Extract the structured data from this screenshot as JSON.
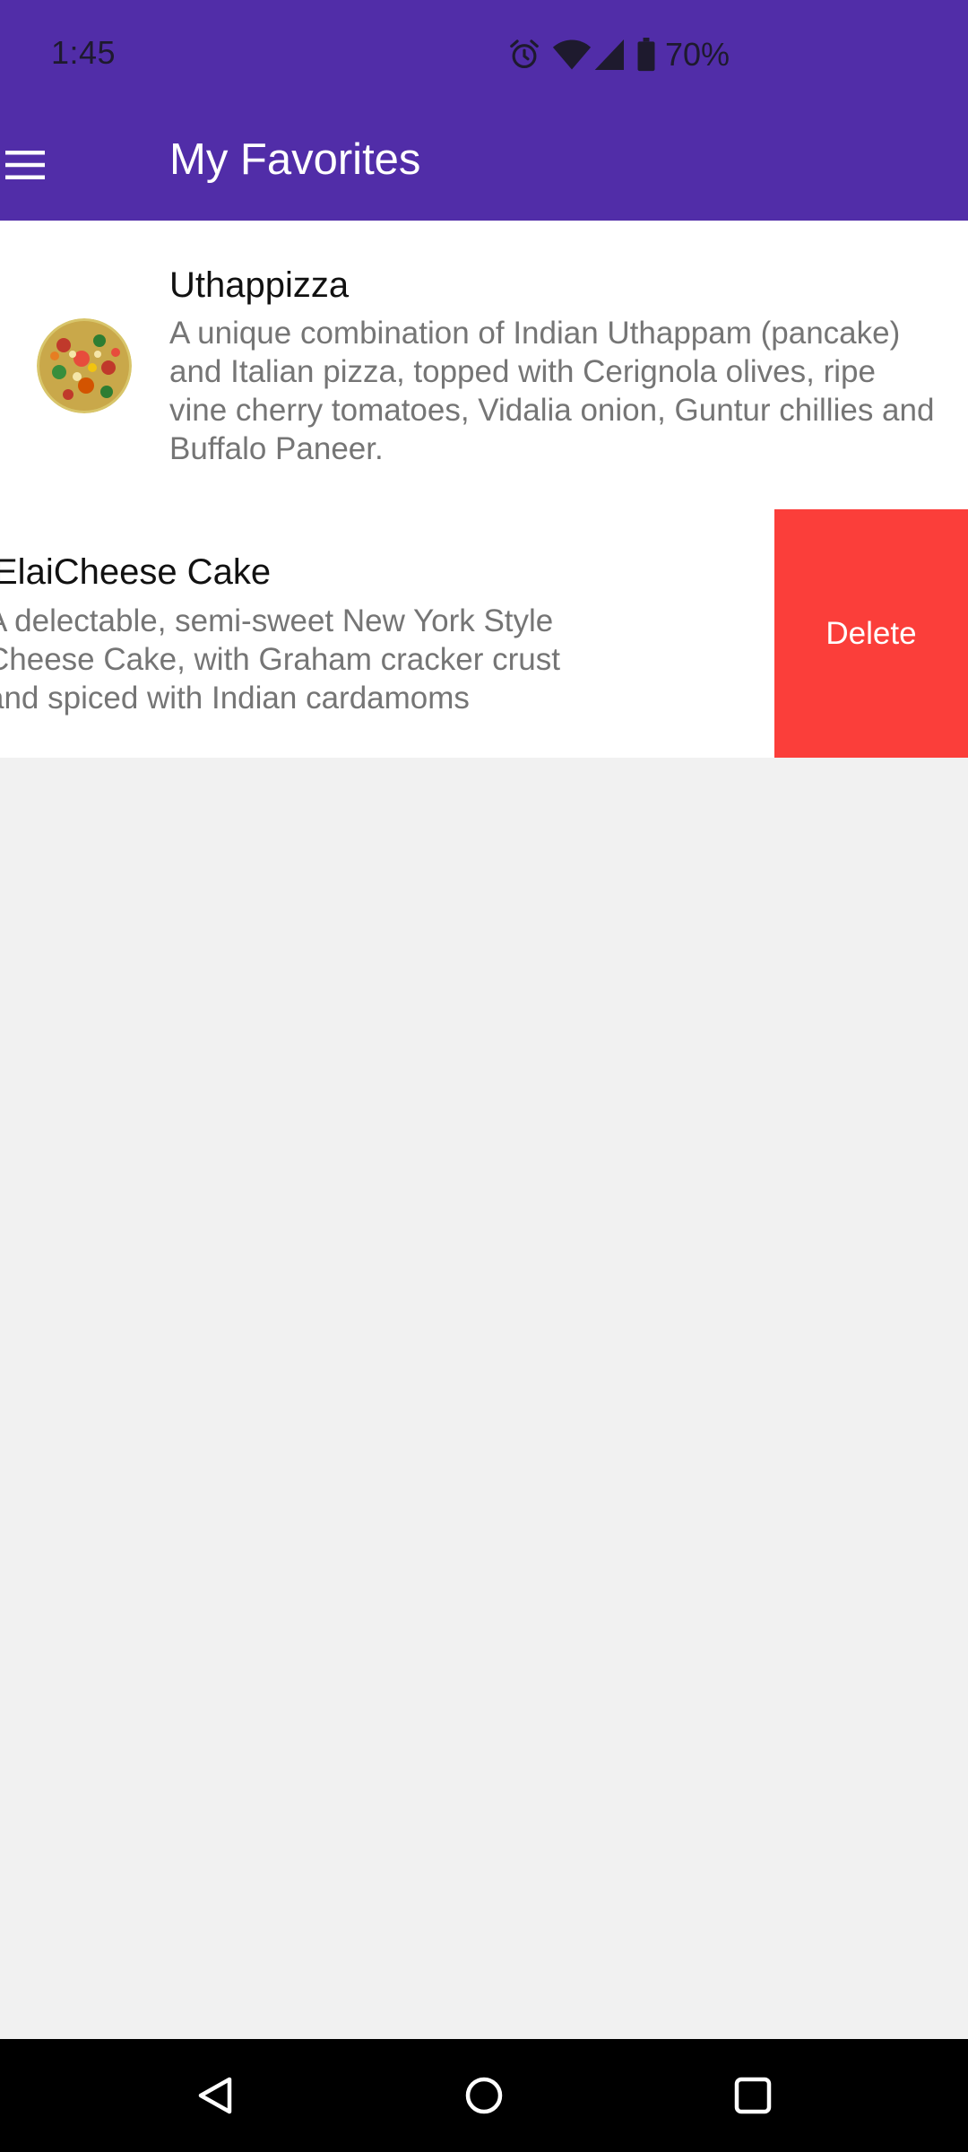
{
  "status_bar": {
    "time": "1:45",
    "battery": "70%",
    "icons": [
      "alarm-icon",
      "wifi-icon",
      "signal-icon",
      "battery-icon"
    ]
  },
  "app_bar": {
    "title": "My Favorites",
    "menu_icon": "hamburger-menu-icon"
  },
  "favorites": [
    {
      "name": "Uthappizza",
      "description": "A unique combination of Indian Uthappam (pancake) and Italian pizza, topped with Cerignola olives, ripe vine cherry tomatoes, Vidalia onion, Guntur chillies and Buffalo Paneer.",
      "image": "pizza-thumbnail"
    },
    {
      "name": "ElaiCheese Cake",
      "description": "A delectable, semi-sweet New York Style Cheese Cake, with Graham cracker crust and spiced with Indian cardamoms",
      "swipe_action": "Delete"
    }
  ],
  "nav_bar": {
    "icons": [
      "back-icon",
      "home-icon",
      "recents-icon"
    ]
  },
  "colors": {
    "primary": "#512da8",
    "delete": "#fb3e3a",
    "background": "#f1f1f1"
  }
}
